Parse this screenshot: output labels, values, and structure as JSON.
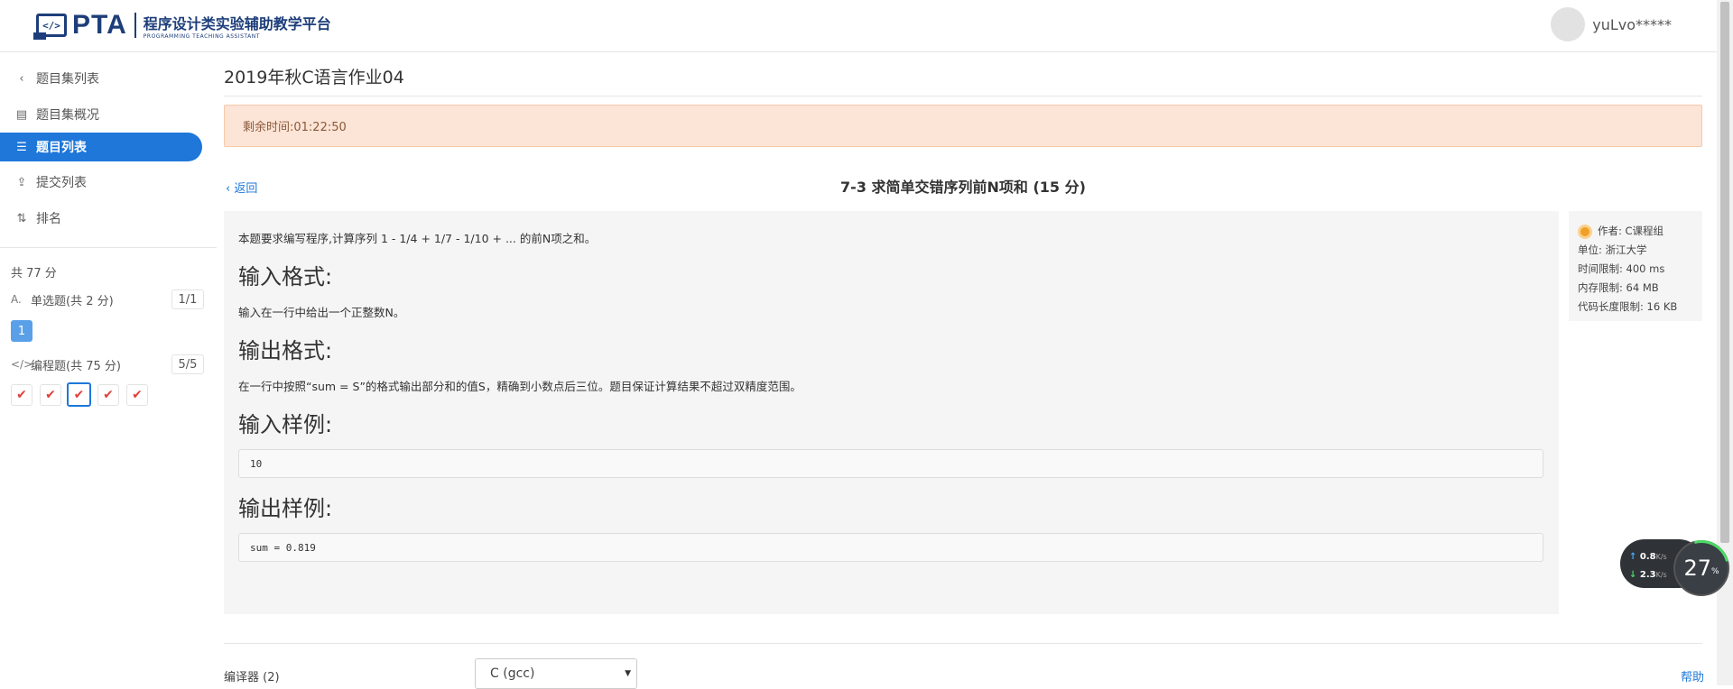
{
  "header": {
    "logo_pta": "PTA",
    "logo_cn": "程序设计类实验辅助教学平台",
    "logo_en": "PROGRAMMING TEACHING ASSISTANT",
    "username": "yuLvo*****"
  },
  "sidebar": {
    "items": [
      {
        "label": "题目集列表",
        "icon": "chevron-left-icon"
      },
      {
        "label": "题目集概况",
        "icon": "book-icon"
      },
      {
        "label": "题目列表",
        "icon": "list-icon"
      },
      {
        "label": "提交列表",
        "icon": "upload-icon"
      },
      {
        "label": "排名",
        "icon": "sort-icon"
      }
    ],
    "total": "共 77 分",
    "single_choice": {
      "label": "单选题(共 2 分)",
      "count": "1/1",
      "numbers": [
        "1"
      ]
    },
    "programming": {
      "label": "编程题(共 75 分)",
      "count": "5/5",
      "checks": 5,
      "active_index": 2
    }
  },
  "main": {
    "page_title": "2019年秋C语言作业04",
    "timer": "剩余时间:01:22:50",
    "back": "返回",
    "problem_title": "7-3 求简单交错序列前N项和 (15 分)",
    "description": "本题要求编写程序,计算序列 1 - 1/4 + 1/7 - 1/10 + ... 的前N项之和。",
    "input_heading": "输入格式:",
    "input_text": "输入在一行中给出一个正整数N。",
    "output_heading": "输出格式:",
    "output_text": "在一行中按照“sum = S”的格式输出部分和的值S，精确到小数点后三位。题目保证计算结果不超过双精度范围。",
    "sample_in_heading": "输入样例:",
    "sample_in": "10",
    "sample_out_heading": "输出样例:",
    "sample_out": "sum = 0.819"
  },
  "info": {
    "author": "作者: C课程组",
    "unit": "单位: 浙江大学",
    "time_limit": "时间限制: 400 ms",
    "memory_limit": "内存限制: 64 MB",
    "code_limit": "代码长度限制: 16 KB"
  },
  "footer": {
    "compiler_label": "编译器 (2)",
    "compiler_value": "C (gcc)",
    "help": "帮助"
  },
  "network_widget": {
    "up": "0.8",
    "down": "2.3",
    "unit": "K/s",
    "percent": "27",
    "percent_sign": "%"
  },
  "colors": {
    "accent": "#1e77d9",
    "timer_bg": "#fce4d6",
    "check_red": "#e2403a",
    "brand": "#1d3e7a"
  }
}
